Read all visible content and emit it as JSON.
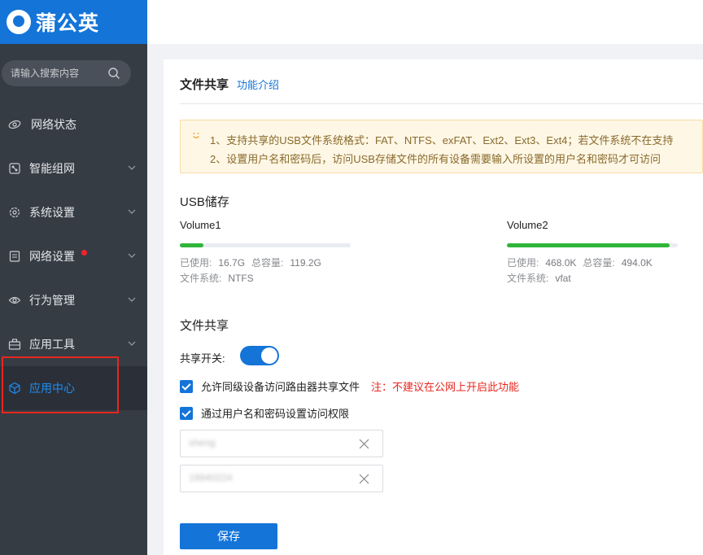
{
  "brand": {
    "name": "蒲公英"
  },
  "search": {
    "placeholder": "请输入搜索内容"
  },
  "sidebar": {
    "items": [
      {
        "label": "网络状态",
        "icon": "network-status-icon"
      },
      {
        "label": "智能组网",
        "icon": "smart-network-icon"
      },
      {
        "label": "系统设置",
        "icon": "gear-icon"
      },
      {
        "label": "网络设置",
        "icon": "network-settings-icon"
      },
      {
        "label": "行为管理",
        "icon": "behavior-icon"
      },
      {
        "label": "应用工具",
        "icon": "toolbox-icon"
      },
      {
        "label": "应用中心",
        "icon": "cube-icon"
      }
    ]
  },
  "page": {
    "title": "文件共享",
    "help_link": "功能介绍"
  },
  "notice": {
    "line1": "1、支持共享的USB文件系统格式：FAT、NTFS、exFAT、Ext2、Ext3、Ext4；若文件系统不在支持",
    "line2": "2、设置用户名和密码后，访问USB存储文件的所有设备需要输入所设置的用户名和密码才可访问"
  },
  "usb": {
    "title": "USB储存",
    "used_label": "已使用:",
    "capacity_label": "总容量:",
    "fs_label": "文件系统:",
    "volumes": [
      {
        "name": "Volume1",
        "used": "16.7G",
        "capacity": "119.2G",
        "fs": "NTFS",
        "fraction": 0.14
      },
      {
        "name": "Volume2",
        "used": "468.0K",
        "capacity": "494.0K",
        "fs": "vfat",
        "fraction": 0.95
      }
    ]
  },
  "share": {
    "title": "文件共享",
    "switch_label": "共享开关:",
    "switch_on": true,
    "allow_lan_label": "允许同级设备访问路由器共享文件",
    "warning": "注：不建议在公网上开启此功能",
    "auth_label": "通过用户名和密码设置访问权限",
    "username": "sheng",
    "password": "19940224"
  },
  "save_label": "保存",
  "colors": {
    "brand": "#1474d8",
    "sidebar": "#363c44",
    "progress": "#2fb53a",
    "warning": "#e8261f"
  }
}
